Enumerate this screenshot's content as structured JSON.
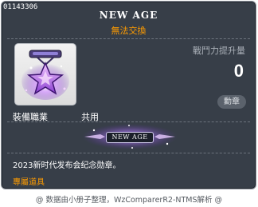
{
  "tooltip": {
    "item_id": "01143306",
    "item_name": "NEW AGE",
    "trade_status": "無法交換",
    "stat_label": "戰鬥力提升量",
    "stat_value": "0",
    "item_type": "勳章",
    "job_label": "裝備職業",
    "job_value": "共用",
    "title_text": "NEW AGE",
    "description": "2023新时代发布会纪念勋章。",
    "exclusive_label": "專屬道具"
  },
  "footer": {
    "credit": "@ 数据由小册子整理，WzComparerR2-NTMS解析 @"
  },
  "colors": {
    "panel_bg": "#373e48",
    "accent_orange": "#ff9c00",
    "medal_purple": "#b06cff"
  }
}
